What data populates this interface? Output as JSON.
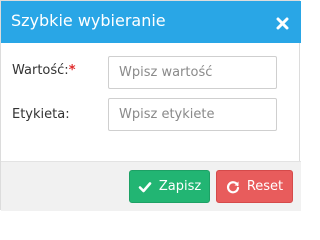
{
  "dialog": {
    "title": "Szybkie wybieranie",
    "close_icon": "close-icon"
  },
  "form": {
    "value_label": "Wartość:",
    "value_required_mark": "*",
    "value_placeholder": "Wpisz wartość",
    "label_label": "Etykieta:",
    "label_placeholder": "Wpisz etykiete"
  },
  "footer": {
    "save_label": "Zapisz",
    "save_icon": "check-icon",
    "reset_label": "Reset",
    "reset_icon": "refresh-icon"
  },
  "colors": {
    "header": "#29a6e6",
    "save_button": "#22b573",
    "reset_button": "#e85c5c",
    "required_mark": "#e02b2b"
  }
}
